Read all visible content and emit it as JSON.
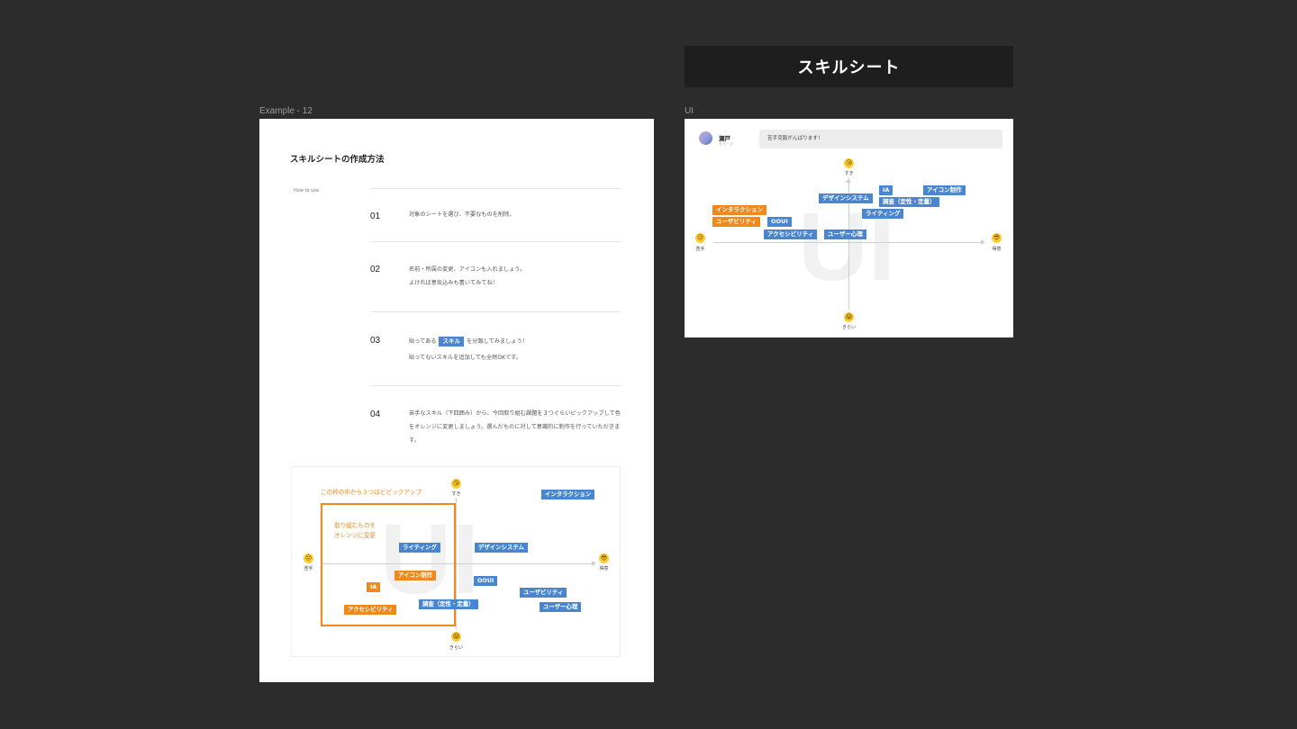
{
  "canvas": {
    "background": "#2c2c2c"
  },
  "right_banner": {
    "title": "スキルシート"
  },
  "left_frame": {
    "label": "Example - 12",
    "title": "スキルシートの作成方法",
    "howto_label": "How to use",
    "steps": [
      {
        "num": "01",
        "text": "対象のシートを選び、不要なものを削除。"
      },
      {
        "num": "02",
        "line1": "名前・所属の変更、アイコンも入れましょう。",
        "line2": "よければ意気込みも書いてみてね！"
      },
      {
        "num": "03",
        "pre": "貼ってある",
        "tag": "スキル",
        "post": "を分類してみましょう！",
        "line2": "貼ってないスキルを追加しても全然OKです。"
      },
      {
        "num": "04",
        "text": "苦手なスキル（下四囲み）から、今回取り組む課題を３つぐらいピックアップして色をオレンジに変更しましょう。選んだものに対して意識的に制作を行っていただきます。"
      }
    ],
    "board": {
      "watermark": "UI",
      "axis": {
        "top_label": "すき",
        "bottom_label": "きらい",
        "left_label": "苦手",
        "right_label": "得意"
      },
      "pick_caption": "この枠の中から３つほどピックアップ",
      "change_note_line1": "取り組むものを",
      "change_note_line2": "オレンジに変更",
      "tags": [
        {
          "id": "interaction",
          "label": "インタラクション",
          "color": "blue"
        },
        {
          "id": "writing",
          "label": "ライティング",
          "color": "blue"
        },
        {
          "id": "design-system",
          "label": "デザインシステム",
          "color": "blue"
        },
        {
          "id": "icon",
          "label": "アイコン制作",
          "color": "orange"
        },
        {
          "id": "ooui",
          "label": "OOUI",
          "color": "blue"
        },
        {
          "id": "ia",
          "label": "IA",
          "color": "orange"
        },
        {
          "id": "research",
          "label": "調査（定性・定量）",
          "color": "blue"
        },
        {
          "id": "usability",
          "label": "ユーザビリティ",
          "color": "blue"
        },
        {
          "id": "accessibility",
          "label": "アクセシビリティ",
          "color": "orange"
        },
        {
          "id": "psychology",
          "label": "ユーザー心理",
          "color": "blue"
        }
      ]
    }
  },
  "right_frame": {
    "label": "UI",
    "profile": {
      "name": "瀬戸",
      "sub": "せと・シ"
    },
    "bubble_text": "苦手克服がんばります！",
    "watermark": "UI",
    "axis": {
      "top_label": "すき",
      "bottom_label": "きらい",
      "left_label": "苦手",
      "right_label": "得意"
    },
    "tags": [
      {
        "id": "ia",
        "label": "IA",
        "color": "blue"
      },
      {
        "id": "icon",
        "label": "アイコン制作",
        "color": "blue"
      },
      {
        "id": "design-system",
        "label": "デザインシステム",
        "color": "blue"
      },
      {
        "id": "research",
        "label": "調査（定性・定量）",
        "color": "blue"
      },
      {
        "id": "interaction",
        "label": "インタラクション",
        "color": "orange"
      },
      {
        "id": "writing",
        "label": "ライティング",
        "color": "blue"
      },
      {
        "id": "usability",
        "label": "ユーザビリティ",
        "color": "orange"
      },
      {
        "id": "ooui",
        "label": "OOUI",
        "color": "blue"
      },
      {
        "id": "accessibility",
        "label": "アクセシビリティ",
        "color": "blue"
      },
      {
        "id": "psychology",
        "label": "ユーザー心理",
        "color": "blue"
      }
    ]
  },
  "colors": {
    "tag_blue": "#4a86cf",
    "tag_orange": "#f0881b",
    "emoji_yellow": "#ffcc33"
  },
  "icons": {
    "top": "kiss-face-icon",
    "bottom": "scream-face-icon",
    "left": "pensive-face-icon",
    "right": "sunglasses-face-icon"
  }
}
